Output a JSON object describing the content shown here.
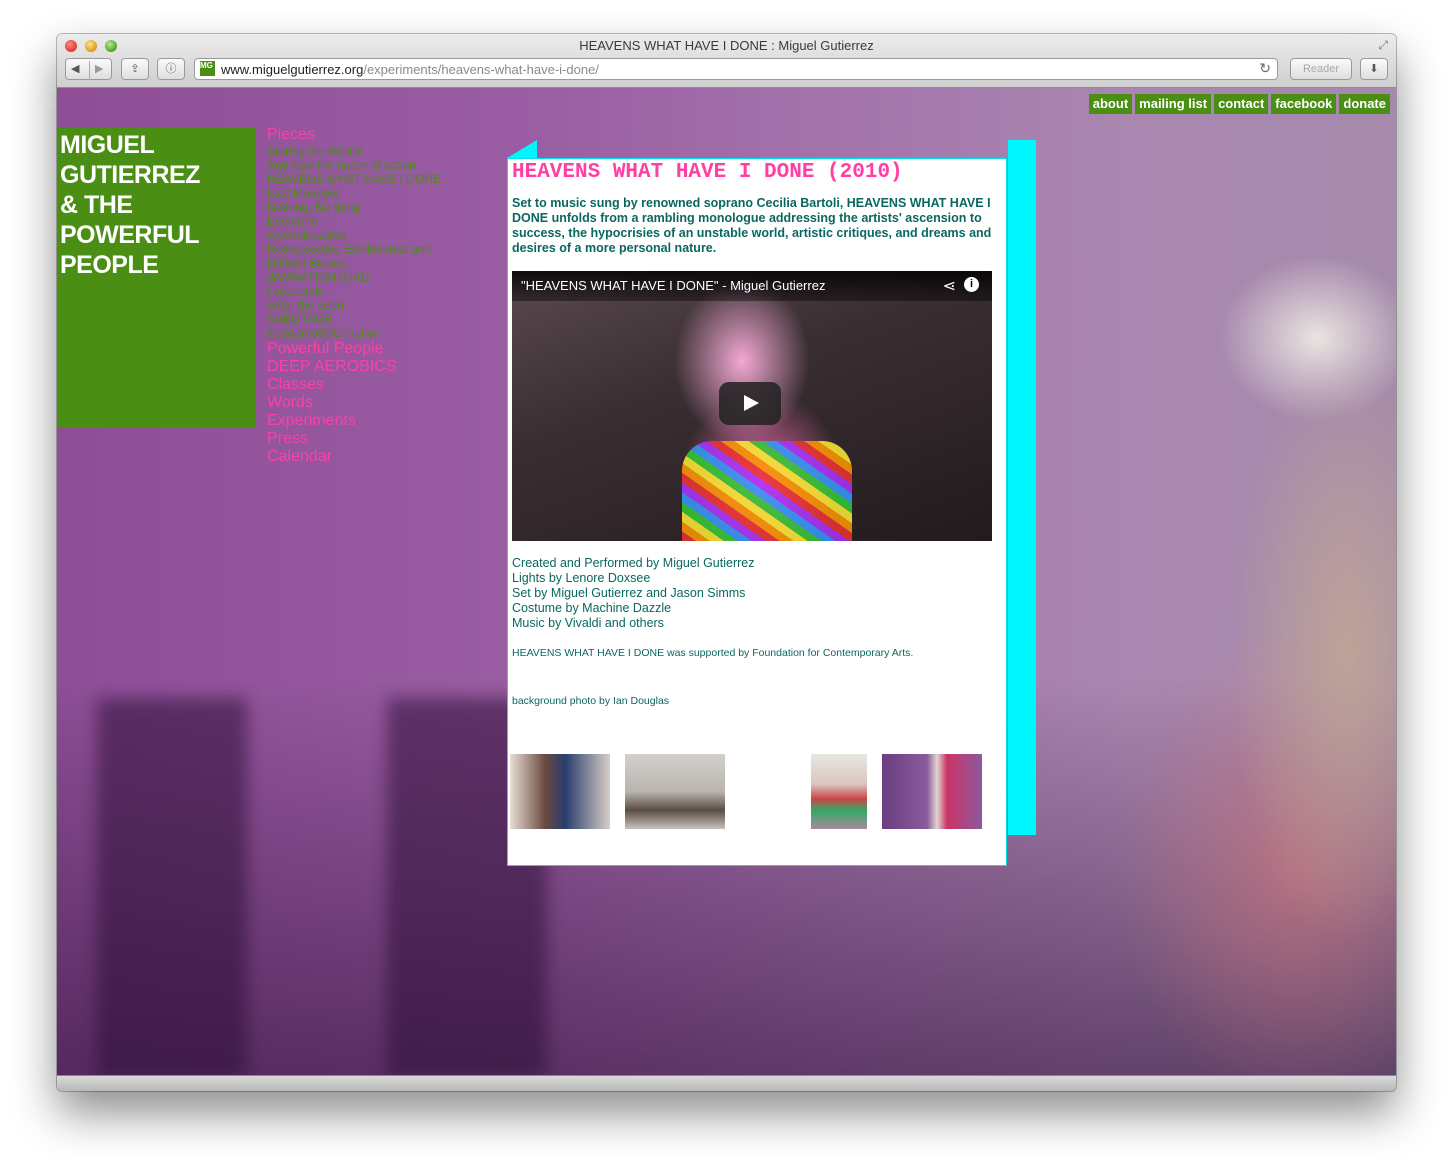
{
  "browser": {
    "window_title": "HEAVENS WHAT HAVE I DONE : Miguel Gutierrez",
    "url_domain": "www.miguelgutierrez.org",
    "url_path": "/experiments/heavens-what-have-i-done/",
    "favicon_text": "MG",
    "reader_label": "Reader",
    "icons": [
      "back-arrow-icon",
      "forward-arrow-icon",
      "share-icon",
      "info-icon",
      "reload-icon",
      "download-icon",
      "fullscreen-icon"
    ]
  },
  "top_links": [
    "about",
    "mailing list",
    "contact",
    "facebook",
    "donate"
  ],
  "logo": {
    "line1": "MIGUEL",
    "line2": "GUTIERREZ",
    "line3": "& THE",
    "line4": "POWERFUL",
    "line5": "PEOPLE"
  },
  "nav": {
    "pieces_label": "Pieces",
    "pieces": [
      "Storing the Winter",
      "And lose the name of action",
      "HEAVENS WHAT HAVE I DONE",
      "Last Meadow",
      "Nothing, No thing",
      "Everyone",
      "myendlesslove",
      "Retrospective Exhibitionist and",
      "Difficult Bodies",
      "dAMNATION rOAD",
      "I succumb",
      "enter the seen",
      "SABOTAGE",
      "freedomofinformation"
    ],
    "sections": [
      "Powerful People",
      "DEEP AEROBICS",
      "Classes",
      "Words",
      "Experiments",
      "Press",
      "Calendar"
    ]
  },
  "article": {
    "title": "HEAVENS WHAT HAVE I DONE (2010)",
    "intro": "Set to music sung by renowned soprano Cecilia Bartoli, HEAVENS WHAT HAVE I DONE unfolds from a rambling monologue addressing the artists' ascension to success, the hypocrisies of an unstable world, artistic critiques, and dreams and desires of a more personal nature.",
    "video_title": "\"HEAVENS WHAT HAVE I DONE\" - Miguel Gutierrez",
    "credits": [
      "Created and Performed by Miguel Gutierrez",
      "Lights by Lenore Doxsee",
      "Set by Miguel Gutierrez and Jason Simms",
      "Costume by Machine Dazzle",
      "Music by Vivaldi and others"
    ],
    "support": "HEAVENS WHAT HAVE I DONE was supported by Foundation for Contemporary Arts.",
    "photo_credit": "background photo by Ian Douglas"
  },
  "colors": {
    "brand_green": "#4a8f13",
    "nav_pink": "#ff3fa4",
    "accent_cyan": "#00f6ff",
    "text_teal": "#0a6760"
  }
}
